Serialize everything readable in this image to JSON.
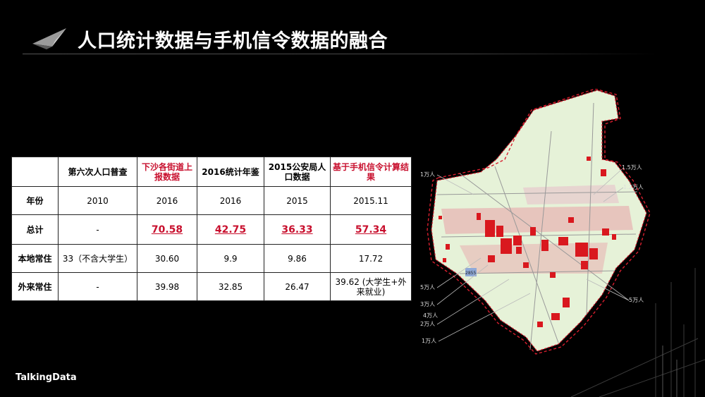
{
  "slide": {
    "title": "人口统计数据与手机信令数据的融合",
    "brand": "TalkingData"
  },
  "table": {
    "header": [
      "",
      "第六次人口普查",
      "下沙各街道上报数据",
      "2016统计年鉴",
      "2015公安局人口数据",
      "基于手机信令计算结果"
    ],
    "rows": [
      {
        "label": "年份",
        "cells": [
          "2010",
          "2016",
          "2016",
          "2015",
          "2015.11"
        ]
      },
      {
        "label": "总计",
        "cells": [
          "-",
          "70.58",
          "42.75",
          "36.33",
          "57.34"
        ]
      },
      {
        "label": "本地常住",
        "cells": [
          "33（不含大学生）",
          "30.60",
          "9.9",
          "9.86",
          "17.72"
        ]
      },
      {
        "label": "外来常住",
        "cells": [
          "-",
          "39.98",
          "32.85",
          "26.47",
          "39.62 (大学生+外来就业)"
        ]
      }
    ]
  },
  "map": {
    "labels": [
      "1万人",
      "1.5万人",
      "1.2万人",
      "5万人",
      "3万人",
      "2万人",
      "1万人",
      "5万人",
      "4万人",
      "2855"
    ],
    "colors": {
      "land": "#e6f2d8",
      "residential": "#e8a0a8",
      "dense": "#d9181e",
      "boundary": "#d81e2e"
    }
  }
}
